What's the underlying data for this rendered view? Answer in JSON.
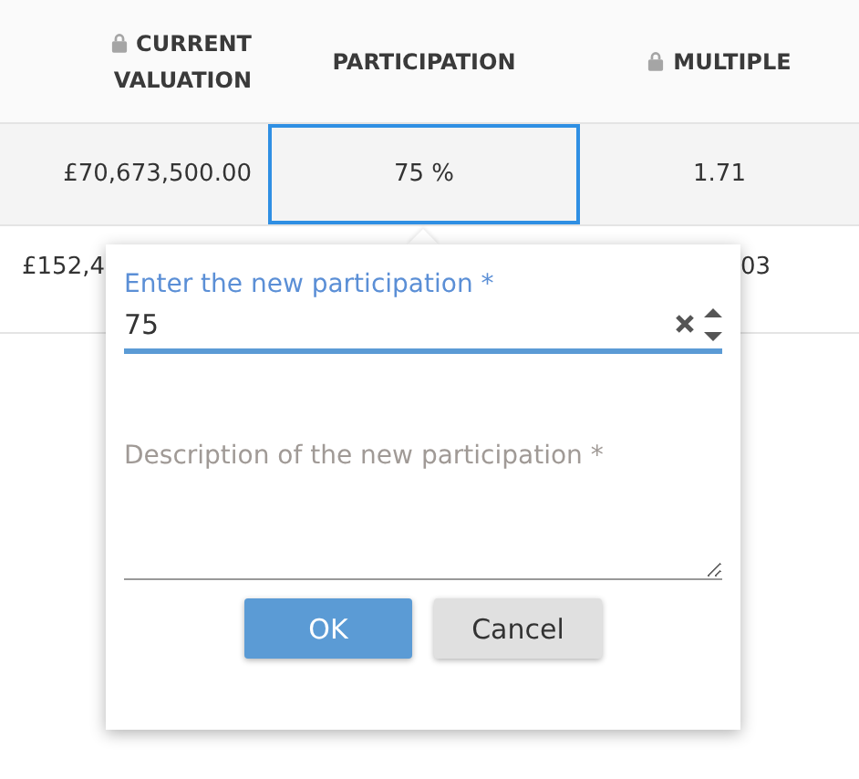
{
  "table": {
    "columns": [
      {
        "label": "CURRENT VALUATION",
        "locked": true
      },
      {
        "label": "PARTICIPATION",
        "locked": false
      },
      {
        "label": "MULTIPLE",
        "locked": true
      }
    ],
    "rows": [
      {
        "selected": true,
        "covered": false,
        "cells": [
          {
            "text": "£70,673,500.00",
            "focused": false
          },
          {
            "text": "75 %",
            "focused": true
          },
          {
            "text": "1.71",
            "focused": false
          }
        ]
      },
      {
        "selected": false,
        "covered": true,
        "cells": [
          {
            "text": "£152,4",
            "focused": false
          },
          {
            "text": "03",
            "focused": false
          }
        ]
      }
    ]
  },
  "popup": {
    "value_field": {
      "label": "Enter the new participation *",
      "value": "75",
      "focused": true
    },
    "description_field": {
      "placeholder": "Description of the new participation *"
    },
    "buttons": [
      {
        "label": "OK",
        "kind": "primary"
      },
      {
        "label": "Cancel",
        "kind": "secondary"
      }
    ]
  }
}
